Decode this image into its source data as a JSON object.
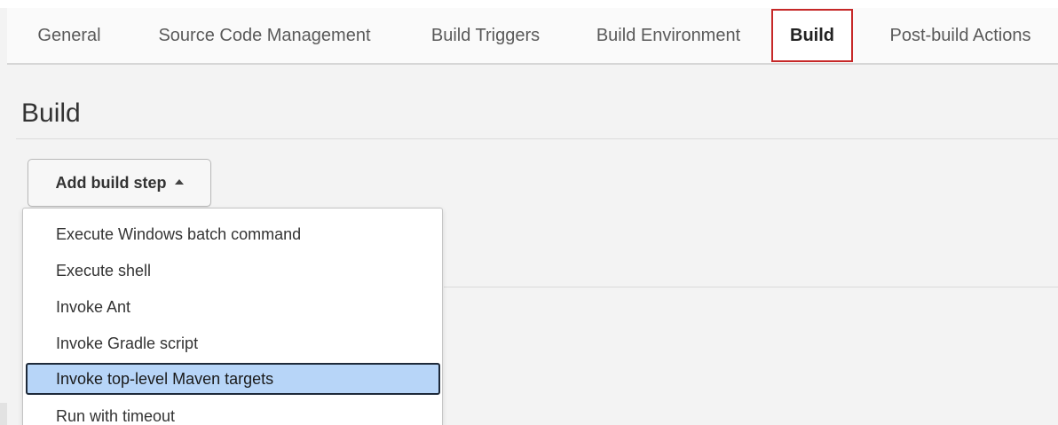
{
  "tabs": [
    {
      "label": "General",
      "active": false
    },
    {
      "label": "Source Code Management",
      "active": false
    },
    {
      "label": "Build Triggers",
      "active": false
    },
    {
      "label": "Build Environment",
      "active": false
    },
    {
      "label": "Build",
      "active": true
    },
    {
      "label": "Post-build Actions",
      "active": false
    }
  ],
  "section": {
    "title": "Build"
  },
  "add_step": {
    "label": "Add build step",
    "icon": "caret-up-icon"
  },
  "menu": {
    "items": [
      {
        "label": "Execute Windows batch command"
      },
      {
        "label": "Execute shell"
      },
      {
        "label": "Invoke Ant"
      },
      {
        "label": "Invoke Gradle script"
      },
      {
        "label": "Invoke top-level Maven targets",
        "highlighted": true
      },
      {
        "label": "Run with timeout"
      }
    ]
  },
  "colors": {
    "active_tab_border": "#c62828",
    "highlight_bg": "#b7d5f8",
    "highlight_border": "#1e2a3a",
    "page_bg": "#f3f3f3"
  }
}
